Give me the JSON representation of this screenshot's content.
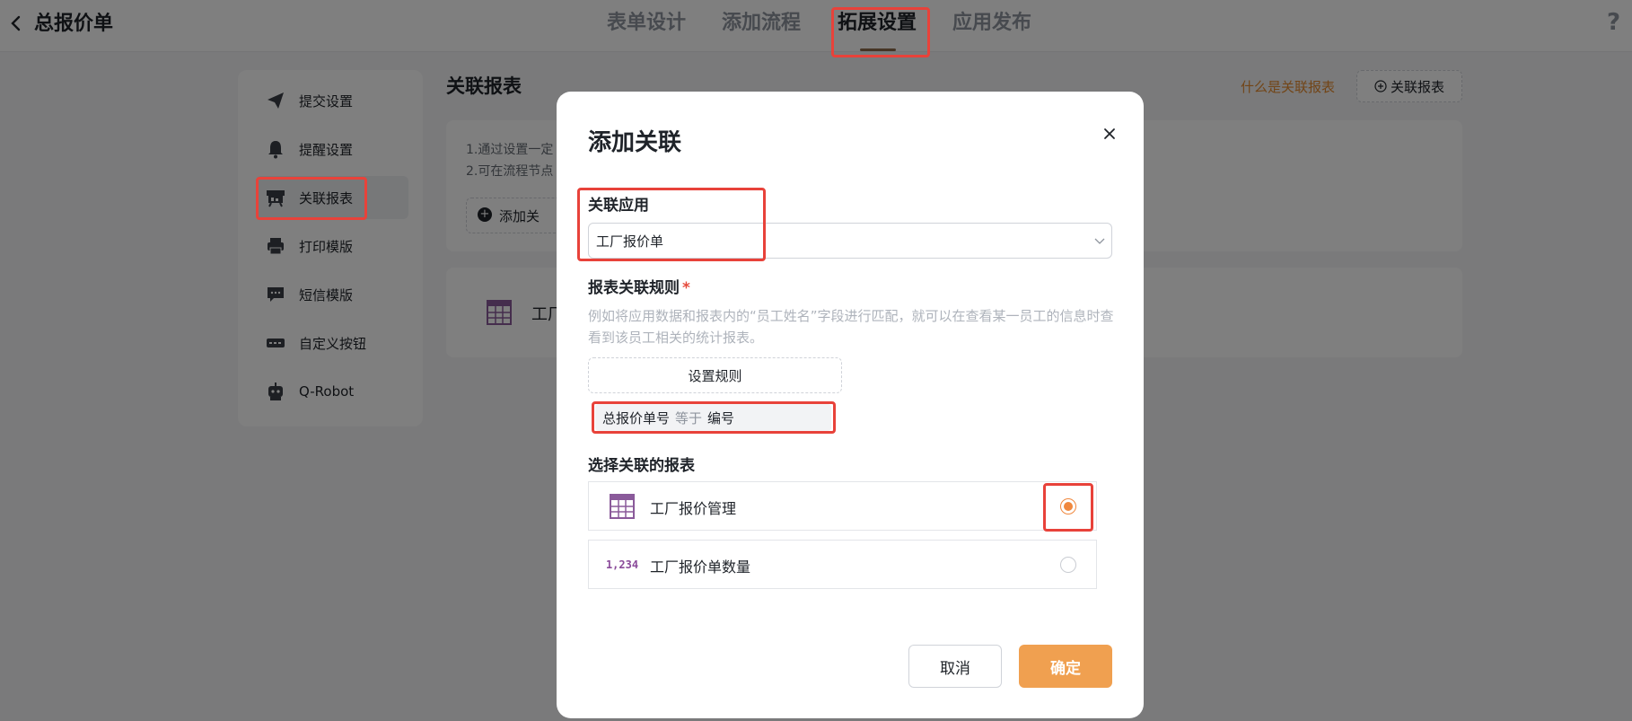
{
  "header": {
    "title": "总报价单",
    "tabs": [
      {
        "label": "表单设计"
      },
      {
        "label": "添加流程"
      },
      {
        "label": "拓展设置"
      },
      {
        "label": "应用发布"
      }
    ],
    "help_label": "?"
  },
  "sidebar": {
    "items": [
      {
        "label": "提交设置",
        "icon": "paper-plane-icon"
      },
      {
        "label": "提醒设置",
        "icon": "bell-icon"
      },
      {
        "label": "关联报表",
        "icon": "report-icon"
      },
      {
        "label": "打印模版",
        "icon": "printer-icon"
      },
      {
        "label": "短信模版",
        "icon": "message-icon"
      },
      {
        "label": "自定义按钮",
        "icon": "custom-button-icon"
      },
      {
        "label": "Q-Robot",
        "icon": "robot-icon"
      }
    ]
  },
  "content": {
    "title": "关联报表",
    "whatis_link": "什么是关联报表",
    "add_report_label": "关联报表",
    "info_lines": [
      "1.通过设置一定",
      "2.可在流程节点"
    ],
    "add_assoc_label": "添加关",
    "assoc_card_label": "工厂"
  },
  "modal": {
    "title": "添加关联",
    "app_section_label": "关联应用",
    "app_select_value": "工厂报价单",
    "rule_section_label": "报表关联规则",
    "required_mark": "*",
    "rule_description": "例如将应用数据和报表内的“员工姓名”字段进行匹配，就可以在查看某一员工的信息时查看到该员工相关的统计报表。",
    "set_rule_label": "设置规则",
    "rule": {
      "left": "总报价单号",
      "operator": "等于",
      "right": "编号"
    },
    "report_section_label": "选择关联的报表",
    "reports": [
      {
        "label": "工厂报价管理",
        "icon": "table-icon",
        "selected": true
      },
      {
        "label": "工厂报价单数量",
        "icon": "number-icon",
        "icon_text": "1,234",
        "selected": false
      }
    ],
    "cancel_label": "取消",
    "confirm_label": "确定"
  },
  "colors": {
    "accent": "#f0a050",
    "radio_selected": "#f0883e",
    "link": "#e58a2f",
    "highlight": "#e8423a"
  }
}
